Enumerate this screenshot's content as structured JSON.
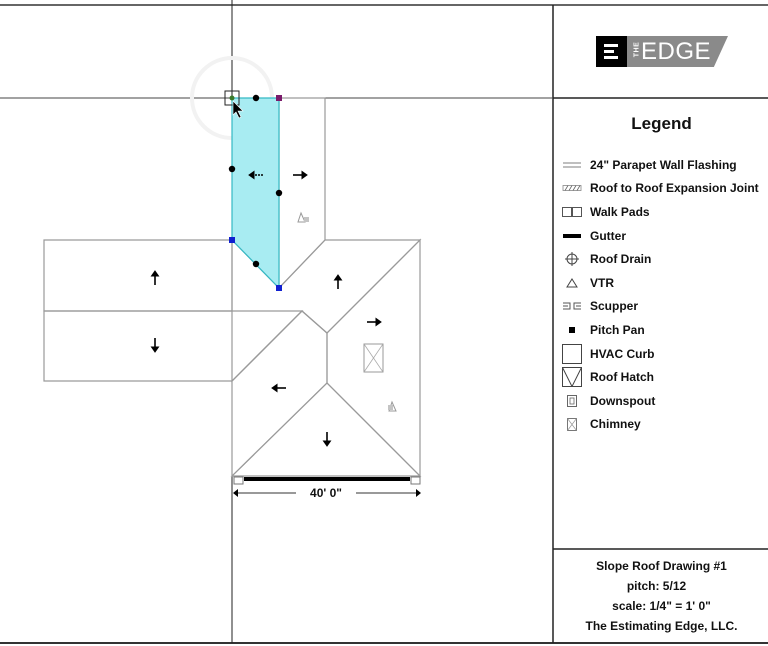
{
  "logo": {
    "mark": "E",
    "the": "THE",
    "word": "EDGE"
  },
  "legend": {
    "title": "Legend",
    "items": [
      {
        "icon": "parapet-wall-flashing-icon",
        "label": "24\" Parapet Wall Flashing"
      },
      {
        "icon": "expansion-joint-icon",
        "label": "Roof to Roof Expansion Joint"
      },
      {
        "icon": "walk-pads-icon",
        "label": "Walk Pads"
      },
      {
        "icon": "gutter-icon",
        "label": "Gutter"
      },
      {
        "icon": "roof-drain-icon",
        "label": "Roof Drain"
      },
      {
        "icon": "vtr-icon",
        "label": "VTR"
      },
      {
        "icon": "scupper-icon",
        "label": "Scupper"
      },
      {
        "icon": "pitch-pan-icon",
        "label": "Pitch Pan"
      },
      {
        "icon": "hvac-curb-icon",
        "label": "HVAC Curb"
      },
      {
        "icon": "roof-hatch-icon",
        "label": "Roof Hatch"
      },
      {
        "icon": "downspout-icon",
        "label": "Downspout"
      },
      {
        "icon": "chimney-icon",
        "label": "Chimney"
      }
    ]
  },
  "title_block": {
    "title": "Slope Roof Drawing #1",
    "pitch": "pitch: 5/12",
    "scale": "scale: 1/4\" = 1' 0\"",
    "company": "The Estimating Edge, LLC."
  },
  "drawing": {
    "dimension_label": "40' 0\"",
    "selected_facet_color": "#a8ecf2",
    "selected_facet_outline": "#35b9c4",
    "vertex_color": "#1020d0",
    "endpoint_color": "#7a1a6a",
    "slope_arrows": [
      {
        "facet": "selected-facet",
        "direction": "left"
      },
      {
        "facet": "upper-right-facet",
        "direction": "right"
      },
      {
        "facet": "left-wing-upper-facet",
        "direction": "up"
      },
      {
        "facet": "left-wing-lower-facet",
        "direction": "down"
      },
      {
        "facet": "center-upper-facet",
        "direction": "up"
      },
      {
        "facet": "right-hip-facet",
        "direction": "right"
      },
      {
        "facet": "left-hip-facet",
        "direction": "left"
      },
      {
        "facet": "bottom-hip-facet",
        "direction": "down"
      }
    ]
  }
}
